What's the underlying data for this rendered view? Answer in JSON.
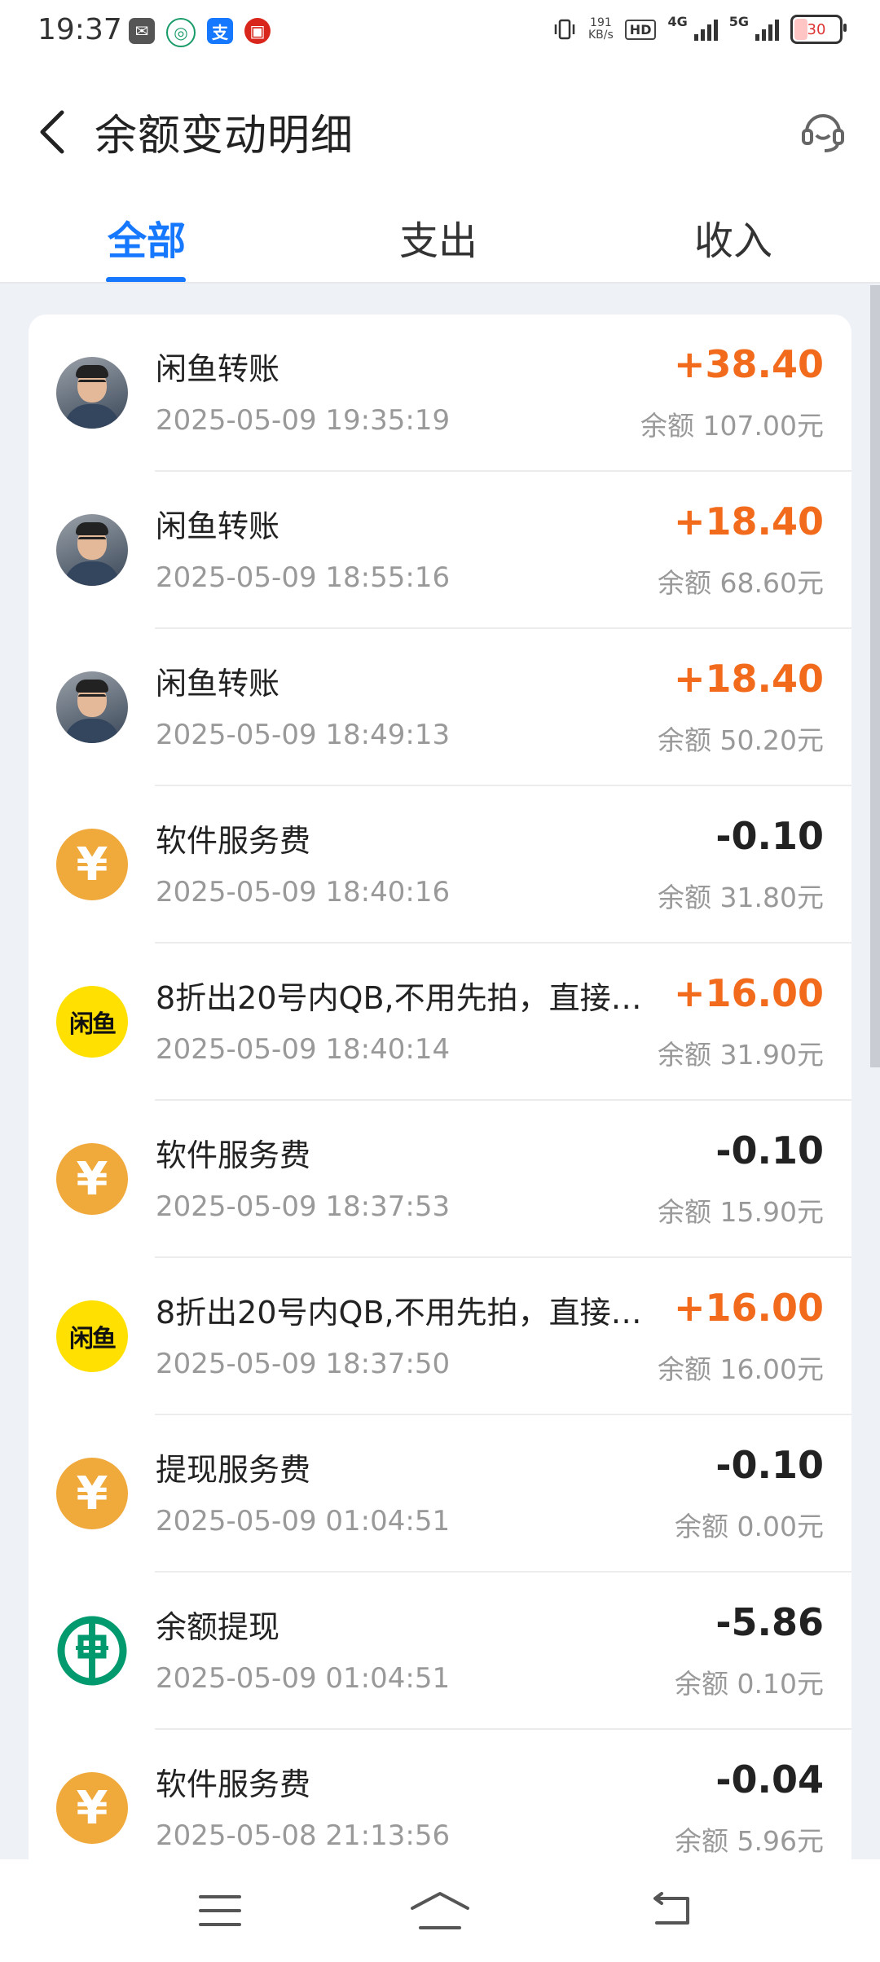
{
  "status_bar": {
    "time": "19:37",
    "speed_value": "191",
    "speed_unit": "KB/s",
    "hd": "HD",
    "net1": "4G",
    "net2": "5G",
    "battery": "30"
  },
  "header": {
    "title": "余额变动明细"
  },
  "tabs": [
    {
      "label": "全部",
      "active": true
    },
    {
      "label": "支出",
      "active": false
    },
    {
      "label": "收入",
      "active": false
    }
  ],
  "transactions": [
    {
      "icon": "user-photo-avatar",
      "name": "闲鱼转账",
      "time": "2025-05-09 19:35:19",
      "amount": "+38.40",
      "balance": "余额 107.00元"
    },
    {
      "icon": "user-photo-avatar",
      "name": "闲鱼转账",
      "time": "2025-05-09 18:55:16",
      "amount": "+18.40",
      "balance": "余额 68.60元"
    },
    {
      "icon": "user-photo-avatar",
      "name": "闲鱼转账",
      "time": "2025-05-09 18:49:13",
      "amount": "+18.40",
      "balance": "余额 50.20元"
    },
    {
      "icon": "yuan-icon",
      "name": "软件服务费",
      "time": "2025-05-09 18:40:16",
      "amount": "-0.10",
      "balance": "余额 31.80元"
    },
    {
      "icon": "xianyu-logo",
      "logo_text": "闲鱼",
      "name": "8折出20号内QB,不用先拍，直接…",
      "time": "2025-05-09 18:40:14",
      "amount": "+16.00",
      "balance": "余额 31.90元"
    },
    {
      "icon": "yuan-icon",
      "name": "软件服务费",
      "time": "2025-05-09 18:37:53",
      "amount": "-0.10",
      "balance": "余额 15.90元"
    },
    {
      "icon": "xianyu-logo",
      "logo_text": "闲鱼",
      "name": "8折出20号内QB,不用先拍，直接…",
      "time": "2025-05-09 18:37:50",
      "amount": "+16.00",
      "balance": "余额 16.00元"
    },
    {
      "icon": "yuan-icon",
      "name": "提现服务费",
      "time": "2025-05-09 01:04:51",
      "amount": "-0.10",
      "balance": "余额 0.00元"
    },
    {
      "icon": "bank-logo",
      "name": "余额提现",
      "time": "2025-05-09 01:04:51",
      "amount": "-5.86",
      "balance": "余额 0.10元"
    },
    {
      "icon": "yuan-icon",
      "name": "软件服务费",
      "time": "2025-05-08 21:13:56",
      "amount": "-0.04",
      "balance": "余额 5.96元"
    }
  ],
  "colors": {
    "accent": "#1677ff",
    "income": "#f26b1d",
    "expense": "#222222",
    "yuan_icon_bg": "#f0a93b",
    "xianyu_bg": "#ffe000",
    "bank_green": "#009a6e"
  }
}
